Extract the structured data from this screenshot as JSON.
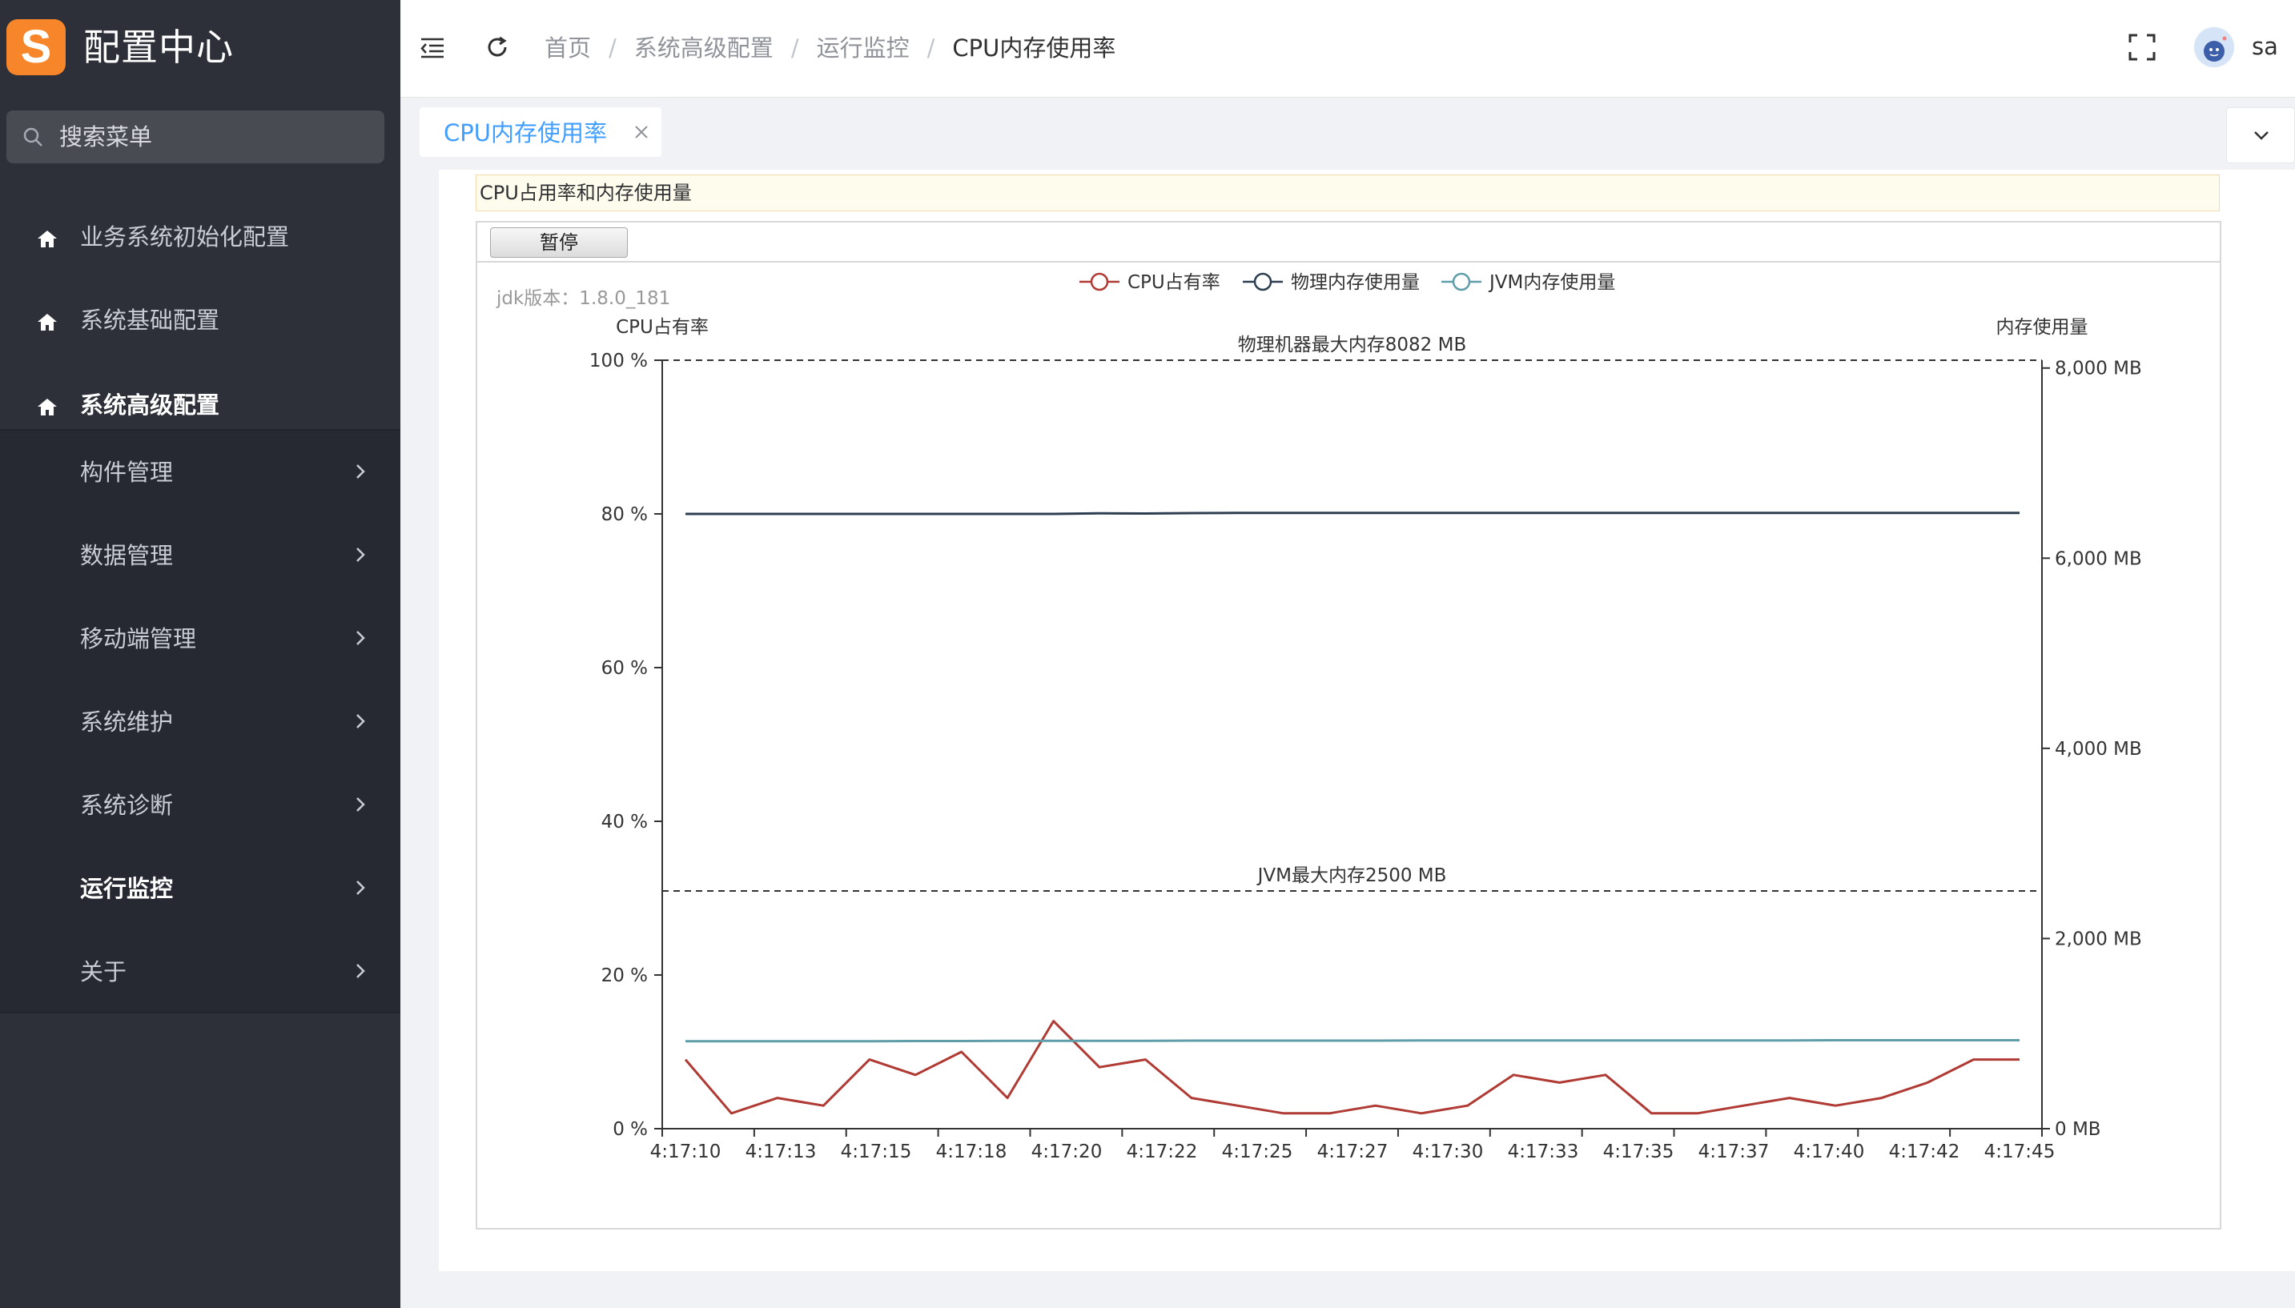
{
  "app": {
    "logo_letter": "S",
    "title": "配置中心"
  },
  "sidebar": {
    "search_placeholder": "搜索菜单",
    "top_items": [
      {
        "label": "业务系统初始化配置",
        "icon": "home-icon"
      },
      {
        "label": "系统基础配置",
        "icon": "home-icon"
      },
      {
        "label": "系统高级配置",
        "icon": "home-icon",
        "active": true
      }
    ],
    "sub_items": [
      {
        "label": "构件管理"
      },
      {
        "label": "数据管理"
      },
      {
        "label": "移动端管理"
      },
      {
        "label": "系统维护"
      },
      {
        "label": "系统诊断"
      },
      {
        "label": "运行监控",
        "active": true
      },
      {
        "label": "关于"
      }
    ]
  },
  "header": {
    "breadcrumb": [
      "首页",
      "系统高级配置",
      "运行监控",
      "CPU内存使用率"
    ],
    "separator": "/",
    "username": "sa"
  },
  "tabs": [
    {
      "label": "CPU内存使用率",
      "active": true
    }
  ],
  "panel": {
    "notice": "CPU占用率和内存使用量",
    "pause_label": "暂停"
  },
  "chart_data": {
    "type": "line",
    "jdk_version_text": "jdk版本：1.8.0_181",
    "legend": [
      "CPU占有率",
      "物理内存使用量",
      "JVM内存使用量"
    ],
    "legend_placement": "top-center",
    "y_left_label": "CPU占有率",
    "y_right_label": "内存使用量",
    "y_left_ticks": [
      "0 %",
      "20 %",
      "40 %",
      "60 %",
      "80 %",
      "100 %"
    ],
    "y_right_ticks": [
      "0 MB",
      "2,000 MB",
      "4,000 MB",
      "6,000 MB",
      "8,000 MB"
    ],
    "y_left_range": [
      0,
      100
    ],
    "y_right_range": [
      0,
      8082
    ],
    "x_tick_labels": [
      "4:17:10",
      "4:17:13",
      "4:17:15",
      "4:17:18",
      "4:17:20",
      "4:17:22",
      "4:17:25",
      "4:17:27",
      "4:17:30",
      "4:17:33",
      "4:17:35",
      "4:17:37",
      "4:17:40",
      "4:17:42",
      "4:17:45"
    ],
    "reference_lines": [
      {
        "label": "物理机器最大内存8082 MB",
        "value_mb": 8082
      },
      {
        "label": "JVM最大内存2500 MB",
        "value_mb": 2500
      }
    ],
    "series": [
      {
        "name": "CPU占有率",
        "axis": "left",
        "color": "#b03a34",
        "values": [
          9,
          2,
          4,
          3,
          9,
          7,
          10,
          4,
          14,
          8,
          9,
          4,
          3,
          2,
          2,
          3,
          2,
          3,
          7,
          6,
          7,
          2,
          2,
          3,
          4,
          3,
          4,
          6,
          9,
          9
        ]
      },
      {
        "name": "物理内存使用量",
        "axis": "right",
        "color": "#2d3e50",
        "values": [
          6466,
          6466,
          6466,
          6466,
          6466,
          6466,
          6466,
          6466,
          6466,
          6472,
          6470,
          6474,
          6476,
          6476,
          6476,
          6476,
          6476,
          6476,
          6476,
          6476,
          6476,
          6476,
          6476,
          6476,
          6476,
          6476,
          6476,
          6476,
          6476,
          6476
        ]
      },
      {
        "name": "JVM内存使用量",
        "axis": "right",
        "color": "#5f9ea8",
        "values": [
          920,
          920,
          920,
          920,
          920,
          922,
          922,
          924,
          924,
          924,
          924,
          926,
          926,
          926,
          926,
          926,
          928,
          928,
          928,
          928,
          928,
          928,
          928,
          928,
          928,
          930,
          930,
          930,
          930,
          930
        ]
      }
    ],
    "grid": false
  },
  "colors": {
    "sidebar_bg": "#2d3038",
    "submenu_bg": "#262931",
    "accent": "#409eff",
    "logo": "#f7862a"
  }
}
